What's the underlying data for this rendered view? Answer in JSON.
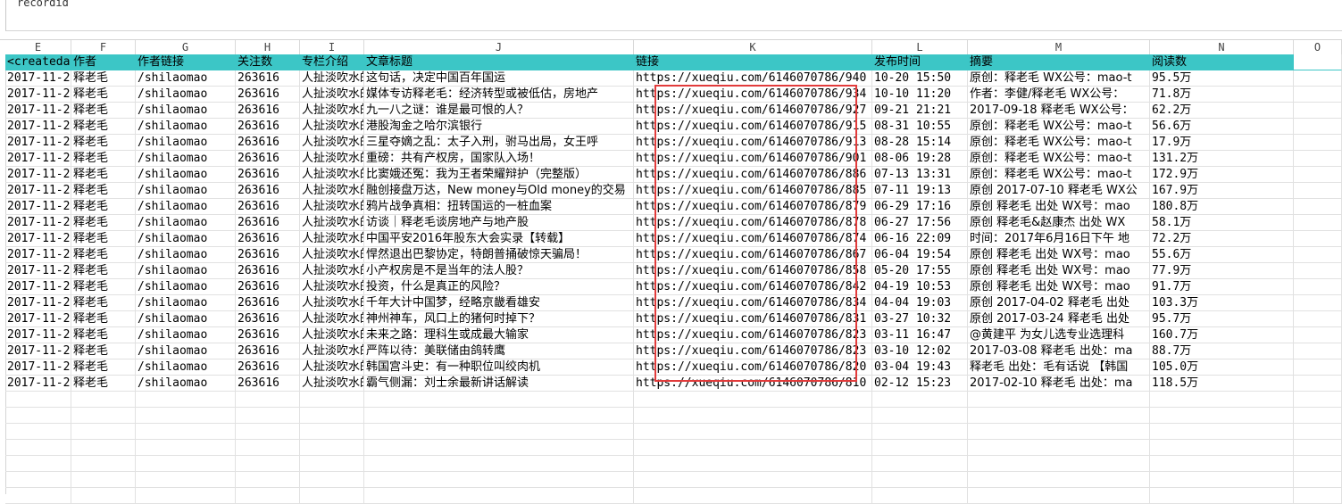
{
  "formula_bar": {
    "text": "recordid"
  },
  "column_letters": [
    "E",
    "F",
    "G",
    "H",
    "I",
    "J",
    "K",
    "L",
    "M",
    "N",
    "O"
  ],
  "header_row": [
    "<createda",
    "作者",
    "作者链接",
    "关注数",
    "专栏介绍",
    "文章标题",
    "链接",
    "发布时间",
    "摘要",
    "阅读数",
    ""
  ],
  "rows": [
    [
      "2017-11-2",
      "释老毛",
      "/shilaomao",
      "263616",
      "人扯淡吹水的",
      "这句话，决定中国百年国运",
      "https://xueqiu.com/6146070786/940",
      "10-20 15:50",
      "原创：释老毛 WX公号：mao-t",
      "95.5万"
    ],
    [
      "2017-11-2",
      "释老毛",
      "/shilaomao",
      "263616",
      "人扯淡吹水的",
      "媒体专访释老毛：经济转型或被低估，房地产",
      "https://xueqiu.com/6146070786/934",
      "10-10 11:20",
      "作者：李健/释老毛 WX公号：",
      "71.8万"
    ],
    [
      "2017-11-2",
      "释老毛",
      "/shilaomao",
      "263616",
      "人扯淡吹水的",
      "九一八之谜：谁是最可恨的人？",
      "https://xueqiu.com/6146070786/927",
      "09-21 21:21",
      "2017-09-18 释老毛 WX公号：",
      "62.2万"
    ],
    [
      "2017-11-2",
      "释老毛",
      "/shilaomao",
      "263616",
      "人扯淡吹水的",
      "港股淘金之哈尔滨银行",
      "https://xueqiu.com/6146070786/915",
      "08-31 10:55",
      "原创：释老毛 WX公号：mao-t",
      "56.6万"
    ],
    [
      "2017-11-2",
      "释老毛",
      "/shilaomao",
      "263616",
      "人扯淡吹水的",
      "三星夺嫡之乱：太子入刑，驸马出局，女王呼",
      "https://xueqiu.com/6146070786/913",
      "08-28 15:14",
      "原创：释老毛 WX公号：mao-t",
      "17.9万"
    ],
    [
      "2017-11-2",
      "释老毛",
      "/shilaomao",
      "263616",
      "人扯淡吹水的",
      "重磅：共有产权房，国家队入场！",
      "https://xueqiu.com/6146070786/901",
      "08-06 19:28",
      "原创：释老毛 WX公号：mao-t",
      "131.2万"
    ],
    [
      "2017-11-2",
      "释老毛",
      "/shilaomao",
      "263616",
      "人扯淡吹水的",
      "比窦娥还冤：我为王者荣耀辩护（完整版）",
      "https://xueqiu.com/6146070786/886",
      "07-13 13:31",
      "原创：释老毛 WX公号：mao-t",
      "172.9万"
    ],
    [
      "2017-11-2",
      "释老毛",
      "/shilaomao",
      "263616",
      "人扯淡吹水的",
      "融创接盘万达，New money与Old money的交易",
      "https://xueqiu.com/6146070786/885",
      "07-11 19:13",
      "原创 2017-07-10 释老毛 WX公",
      "167.9万"
    ],
    [
      "2017-11-2",
      "释老毛",
      "/shilaomao",
      "263616",
      "人扯淡吹水的",
      "鸦片战争真相：扭转国运的一桩血案",
      "https://xueqiu.com/6146070786/879",
      "06-29 17:16",
      "原创 释老毛 出处 WX号：mao",
      "180.8万"
    ],
    [
      "2017-11-2",
      "释老毛",
      "/shilaomao",
      "263616",
      "人扯淡吹水的",
      "访谈｜释老毛谈房地产与地产股",
      "https://xueqiu.com/6146070786/878",
      "06-27 17:56",
      "原创 释老毛&赵康杰 出处 WX",
      "58.1万"
    ],
    [
      "2017-11-2",
      "释老毛",
      "/shilaomao",
      "263616",
      "人扯淡吹水的",
      "中国平安2016年股东大会实录【转载】",
      "https://xueqiu.com/6146070786/874",
      "06-16 22:09",
      "时间：2017年6月16日下午 地",
      "72.2万"
    ],
    [
      "2017-11-2",
      "释老毛",
      "/shilaomao",
      "263616",
      "人扯淡吹水的",
      "悍然退出巴黎协定，特朗普捅破惊天骗局！",
      "https://xueqiu.com/6146070786/867",
      "06-04 19:54",
      "原创 释老毛 出处 WX号：mao",
      "55.6万"
    ],
    [
      "2017-11-2",
      "释老毛",
      "/shilaomao",
      "263616",
      "人扯淡吹水的",
      "小产权房是不是当年的法人股？",
      "https://xueqiu.com/6146070786/858",
      "05-20 17:55",
      "原创 释老毛 出处 WX号：mao",
      "77.9万"
    ],
    [
      "2017-11-2",
      "释老毛",
      "/shilaomao",
      "263616",
      "人扯淡吹水的",
      "投资，什么是真正的风险？",
      "https://xueqiu.com/6146070786/842",
      "04-19 10:53",
      "原创 释老毛 出处 WX号：mao",
      "91.7万"
    ],
    [
      "2017-11-2",
      "释老毛",
      "/shilaomao",
      "263616",
      "人扯淡吹水的",
      "千年大计中国梦，经略京畿看雄安",
      "https://xueqiu.com/6146070786/834",
      "04-04 19:03",
      "原创 2017-04-02 释老毛 出处",
      "103.3万"
    ],
    [
      "2017-11-2",
      "释老毛",
      "/shilaomao",
      "263616",
      "人扯淡吹水的",
      "神州神车，风口上的猪何时掉下？",
      "https://xueqiu.com/6146070786/831",
      "03-27 10:32",
      "原创 2017-03-24 释老毛 出处",
      "95.7万"
    ],
    [
      "2017-11-2",
      "释老毛",
      "/shilaomao",
      "263616",
      "人扯淡吹水的",
      "未来之路：理科生或成最大输家",
      "https://xueqiu.com/6146070786/823",
      "03-11 16:47",
      "@黄建平 为女儿选专业选理科",
      "160.7万"
    ],
    [
      "2017-11-2",
      "释老毛",
      "/shilaomao",
      "263616",
      "人扯淡吹水的",
      "严阵以待：美联储由鸽转鹰",
      "https://xueqiu.com/6146070786/823",
      "03-10 12:02",
      "2017-03-08 释老毛 出处：ma",
      "88.7万"
    ],
    [
      "2017-11-2",
      "释老毛",
      "/shilaomao",
      "263616",
      "人扯淡吹水的",
      "韩国宫斗史：有一种职位叫绞肉机",
      "https://xueqiu.com/6146070786/820",
      "03-04 19:43",
      "释老毛 出处：毛有话说 【韩国",
      "105.0万"
    ],
    [
      "2017-11-2",
      "释老毛",
      "/shilaomao",
      "263616",
      "人扯淡吹水的",
      "霸气侧漏：刘士余最新讲话解读",
      "https://xueqiu.com/6146070786/810",
      "02-12 15:23",
      "2017-02-10 释老毛 出处：ma",
      "118.5万"
    ]
  ],
  "colors": {
    "header_fill": "#3cc6c6",
    "highlight_box": "#e23b3b",
    "grid": "#e1e1e1"
  }
}
